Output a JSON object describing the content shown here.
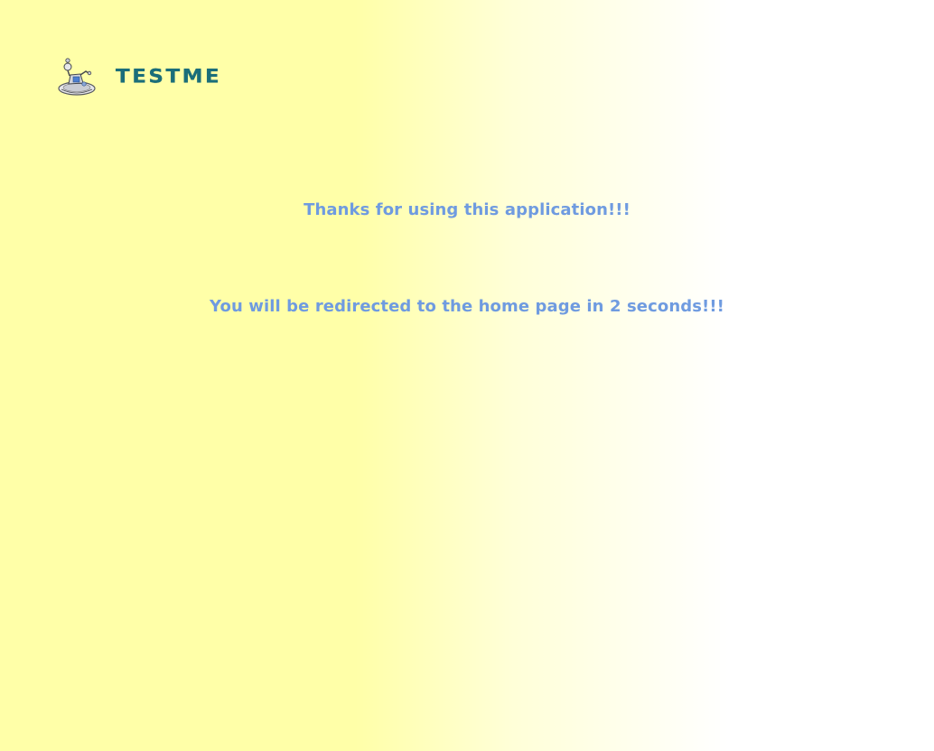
{
  "header": {
    "brand": "TESTME",
    "logo_icon": "robot-mascot-icon"
  },
  "main": {
    "thanks_message": "Thanks for using this application!!!",
    "redirect_message": "You will be redirected to the home page in 2 seconds!!!"
  },
  "colors": {
    "brand_text": "#1a6e7a",
    "message_text": "#6f9be0",
    "background_left": "#ffffa8",
    "background_right": "#ffffff"
  }
}
